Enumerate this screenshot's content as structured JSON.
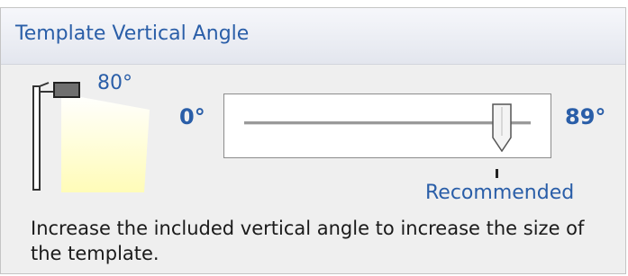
{
  "panel": {
    "title": "Template Vertical Angle"
  },
  "illustration": {
    "angle_label": "80°",
    "icon": "light-pole-icon",
    "light_color": "#fffcc0"
  },
  "slider": {
    "min_label": "0°",
    "max_label": "89°",
    "min": 0,
    "max": 89,
    "value": 80,
    "recommended_value": 80,
    "recommended_label": "Recommended"
  },
  "description": "Increase the included vertical angle to increase the size of the template.",
  "colors": {
    "accent": "#2a5ea8",
    "panel_bg": "#efefef"
  }
}
